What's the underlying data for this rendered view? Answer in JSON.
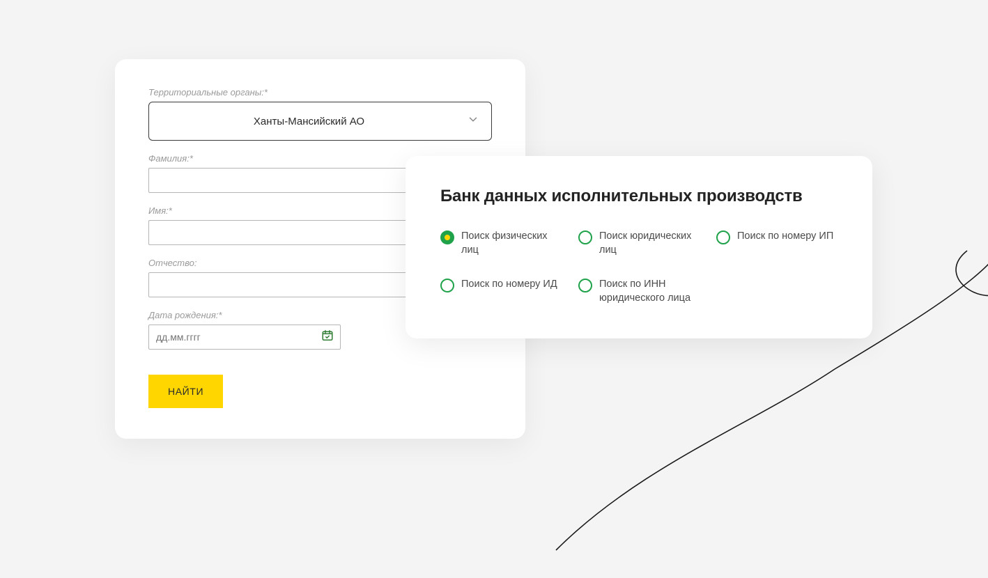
{
  "form": {
    "region_label": "Территориальные органы:*",
    "region_value": "Ханты-Мансийский АО",
    "surname_label": "Фамилия:*",
    "surname_value": "",
    "name_label": "Имя:*",
    "name_value": "",
    "patronymic_label": "Отчество:",
    "patronymic_value": "",
    "birth_label": "Дата рождения:*",
    "birth_placeholder": "дд.мм.гггг",
    "submit_label": "НАЙТИ"
  },
  "options": {
    "title": "Банк данных исполнительных производств",
    "items": [
      {
        "label": "Поиск физических лиц",
        "checked": true
      },
      {
        "label": "Поиск юридических лиц",
        "checked": false
      },
      {
        "label": "Поиск по номеру ИП",
        "checked": false
      },
      {
        "label": "Поиск по номеру ИД",
        "checked": false
      },
      {
        "label": "Поиск по ИНН юридического лица",
        "checked": false
      }
    ]
  }
}
